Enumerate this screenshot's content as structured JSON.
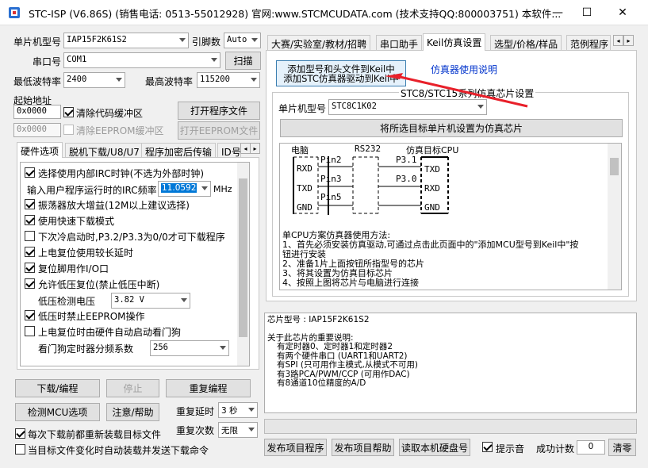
{
  "window": {
    "title": "STC-ISP (V6.86S) (销售电话: 0513-55012928) 官网:www.STCMCUDATA.com  (技术支持QQ:800003751) 本软件...",
    "min": "—",
    "max": "☐",
    "close": "✕"
  },
  "left": {
    "mcu_label": "单片机型号",
    "mcu_value": "IAP15F2K61S2",
    "pin_label": "引脚数",
    "pin_value": "Auto",
    "port_label": "串口号",
    "port_value": "COM1",
    "scan_btn": "扫描",
    "min_baud_label": "最低波特率",
    "min_baud_value": "2400",
    "max_baud_label": "最高波特率",
    "max_baud_value": "115200",
    "start_addr_label": "起始地址",
    "addr1": "0x0000",
    "clear_code": "清除代码缓冲区",
    "open_prog": "打开程序文件",
    "addr2": "0x0000",
    "clear_eeprom": "清除EEPROM缓冲区",
    "open_eeprom": "打开EEPROM文件",
    "tabs": [
      "硬件选项",
      "脱机下载/U8/U7",
      "程序加密后传输",
      "ID号"
    ],
    "options": [
      {
        "label": "选择使用内部IRC时钟(不选为外部时钟)",
        "checked": true
      },
      {
        "label": "输入用户程序运行时的IRC频率",
        "value": "11.0592",
        "unit": "MHz"
      },
      {
        "label": "振荡器放大增益(12M以上建议选择)",
        "checked": true
      },
      {
        "label": "使用快速下载模式",
        "checked": true
      },
      {
        "label": "下次冷启动时,P3.2/P3.3为0/0才可下载程序",
        "checked": false
      },
      {
        "label": "上电复位使用较长延时",
        "checked": true
      },
      {
        "label": "复位脚用作I/O口",
        "checked": true
      },
      {
        "label": "允许低压复位(禁止低压中断)",
        "checked": true
      },
      {
        "label": "低压检测电压",
        "value": "3.82 V"
      },
      {
        "label": "低压时禁止EEPROM操作",
        "checked": true
      },
      {
        "label": "上电复位时由硬件自动启动看门狗",
        "checked": false
      },
      {
        "label": "看门狗定时器分频系数",
        "value": "256"
      }
    ],
    "download_btn": "下载/编程",
    "stop_btn": "停止",
    "reprog_btn": "重复编程",
    "detect_btn": "检测MCU选项",
    "help_btn": "注意/帮助",
    "repeat_delay_label": "重复延时",
    "repeat_delay_value": "3 秒",
    "repeat_count_label": "重复次数",
    "repeat_count_value": "无限",
    "reload_each": "每次下载前都重新装载目标文件",
    "auto_reload": "当目标文件变化时自动装载并发送下载命令"
  },
  "right": {
    "tabs": [
      "大赛/实验室/教材/招聘",
      "串口助手",
      "Keil仿真设置",
      "选型/价格/样品",
      "范例程序"
    ],
    "add_keil_line1": "添加型号和头文件到Keil中",
    "add_keil_line2": "添加STC仿真器驱动到Keil中",
    "emu_help_link": "仿真器使用说明",
    "group_title": "STC8/STC15系列仿真芯片设置",
    "mcu_label": "单片机型号",
    "mcu_value": "STC8C1K02",
    "set_emu_btn": "将所选目标单片机设置为仿真芯片",
    "diagram": {
      "pc": "电脑",
      "rs232": "RS232",
      "target": "仿真目标CPU",
      "rxd": "RXD",
      "txd": "TXD",
      "gnd": "GND",
      "pin2": "Pin2",
      "pin3": "Pin3",
      "pin5": "Pin5",
      "p31": "P3.1",
      "p30": "P3.0",
      "t_txd": "TXD",
      "t_rxd": "RXD",
      "t_gnd": "GND"
    },
    "instructions": [
      "单CPU方案仿真器使用方法:",
      "1、首先必须安装仿真驱动,可通过点击此页面中的\"添加MCU型号到Keil中\"按",
      "钮进行安装",
      "2、准备1片上面按钮所指型号的芯片",
      "3、将其设置为仿真目标芯片",
      "4、按照上图将芯片与电脑进行连接"
    ],
    "info_lines": [
      "芯片型号 : IAP15F2K61S2",
      "",
      "关于此芯片的重要说明:",
      "  有定时器0、定时器1和定时器2",
      "  有两个硬件串口 (UART1和UART2)",
      "  有SPI (只可用作主模式,从模式不可用)",
      "  有3路PCA/PWM/CCP (可用作DAC)",
      "  有8通道10位精度的A/D"
    ],
    "publish_btn": "发布项目程序",
    "publish_help_btn": "发布项目帮助",
    "read_disk_btn": "读取本机硬盘号",
    "sound_label": "提示音",
    "success_label": "成功计数",
    "success_value": "0",
    "clear_btn": "清零"
  }
}
